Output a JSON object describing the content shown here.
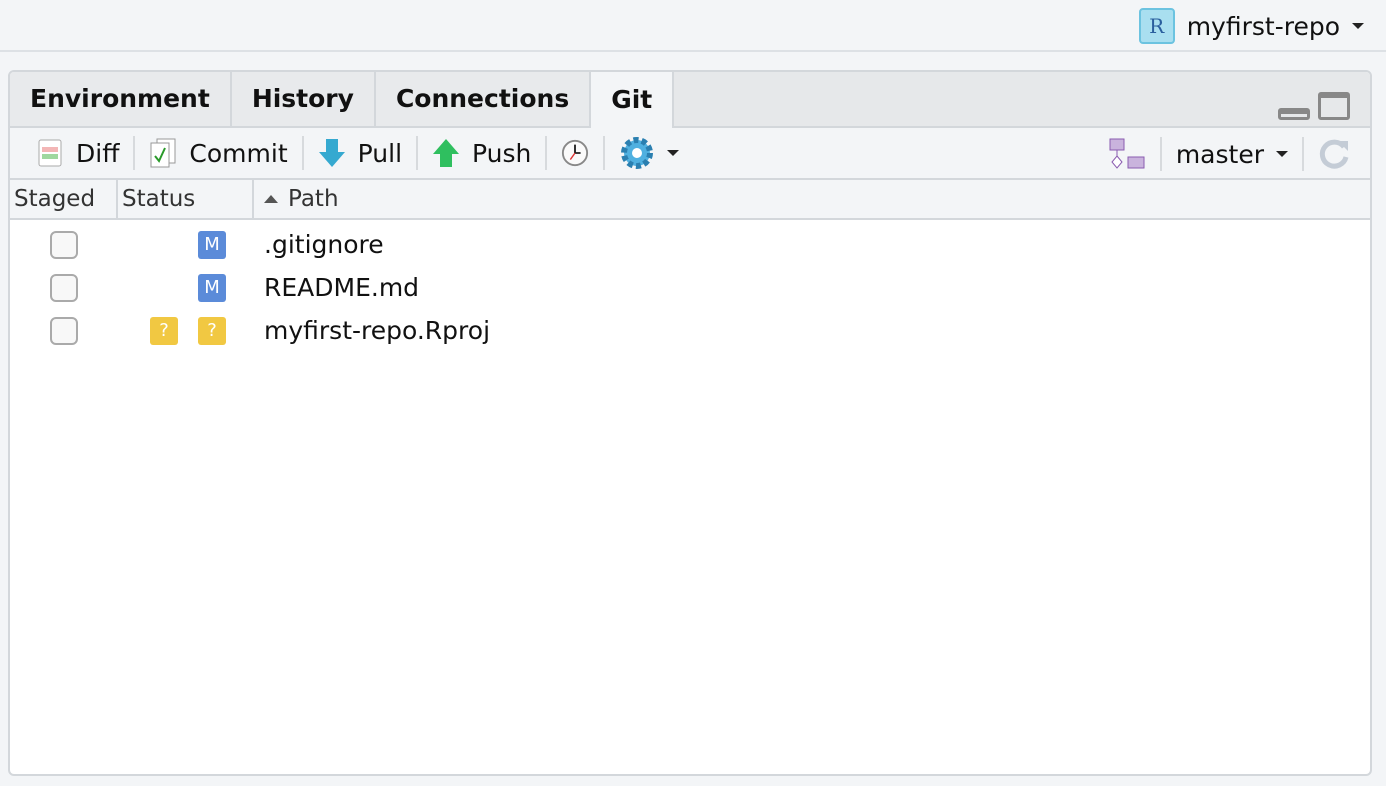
{
  "project": {
    "name": "myfirst-repo",
    "icon": "r-project-cube-icon"
  },
  "tabs": [
    {
      "label": "Environment"
    },
    {
      "label": "History"
    },
    {
      "label": "Connections"
    },
    {
      "label": "Git",
      "active": true
    }
  ],
  "toolbar": {
    "diff": "Diff",
    "commit": "Commit",
    "pull": "Pull",
    "push": "Push",
    "branch": "master"
  },
  "columns": {
    "staged": "Staged",
    "status": "Status",
    "path": "Path"
  },
  "files": [
    {
      "staged": false,
      "status_staged": "",
      "status_unstaged": "M",
      "path": ".gitignore"
    },
    {
      "staged": false,
      "status_staged": "",
      "status_unstaged": "M",
      "path": "README.md"
    },
    {
      "staged": false,
      "status_staged": "?",
      "status_unstaged": "?",
      "path": "myfirst-repo.Rproj"
    }
  ],
  "colors": {
    "modified": "#5b8bd9",
    "untracked": "#f1c842"
  }
}
